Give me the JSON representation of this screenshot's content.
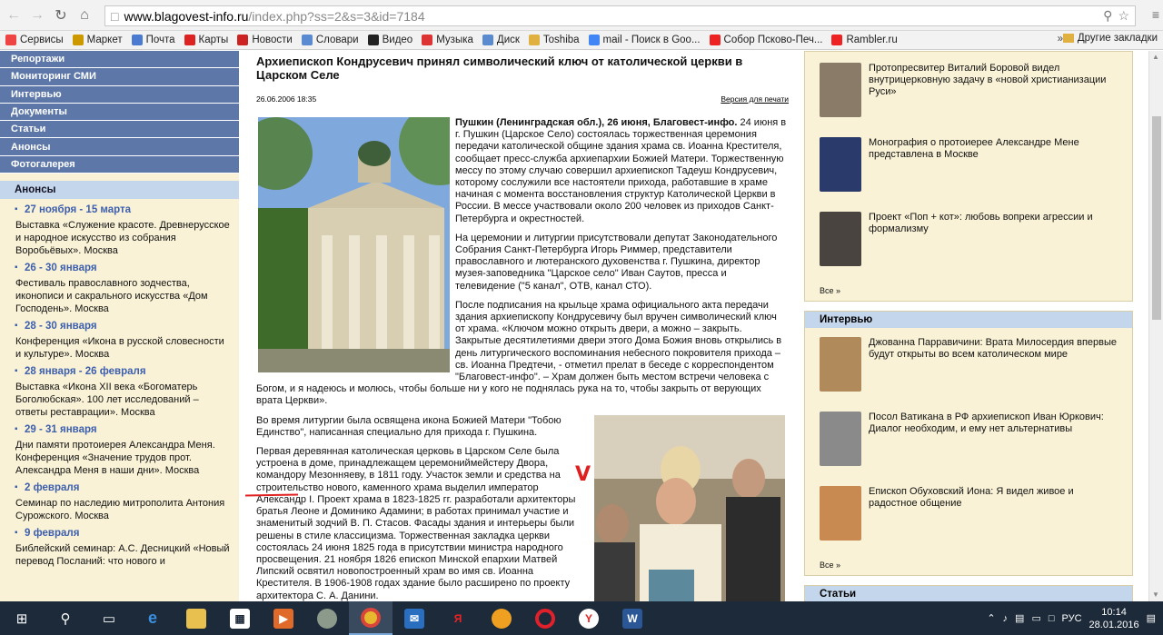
{
  "browser": {
    "url_domain": "www.blagovest-info.ru",
    "url_path": "/index.php?ss=2&s=3&id=7184",
    "bookmarks": [
      {
        "label": "Сервисы",
        "icon": "apps-icon",
        "color": "#e44"
      },
      {
        "label": "Маркет",
        "icon": "market-icon",
        "color": "#c90"
      },
      {
        "label": "Почта",
        "icon": "mail-icon",
        "color": "#4a7bd0"
      },
      {
        "label": "Карты",
        "icon": "map-pin-icon",
        "color": "#d22"
      },
      {
        "label": "Новости",
        "icon": "news-icon",
        "color": "#c22"
      },
      {
        "label": "Словари",
        "icon": "dictionary-icon",
        "color": "#5a8ad0"
      },
      {
        "label": "Видео",
        "icon": "video-icon",
        "color": "#222"
      },
      {
        "label": "Музыка",
        "icon": "music-icon",
        "color": "#d33"
      },
      {
        "label": "Диск",
        "icon": "disk-icon",
        "color": "#5a8ad0"
      },
      {
        "label": "Toshiba",
        "icon": "folder-icon",
        "color": "#e0b040"
      },
      {
        "label": "mail - Поиск в Goo...",
        "icon": "google-icon",
        "color": "#4285f4"
      },
      {
        "label": "Собор Псково-Печ...",
        "icon": "yandex-icon",
        "color": "#e22"
      },
      {
        "label": "Rambler.ru",
        "icon": "yandex-icon",
        "color": "#e22"
      }
    ],
    "more": "»",
    "other_bookmarks": "Другие закладки"
  },
  "left_menu": [
    "Репортажи",
    "Мониторинг СМИ",
    "Интервью",
    "Документы",
    "Статьи",
    "Анонсы",
    "Фотогалерея"
  ],
  "announcements": {
    "heading": "Анонсы",
    "items": [
      {
        "date": "27 ноября - 15 марта",
        "desc": "Выставка «Служение красоте. Древнерусское и народное искусство из собрания Воробьёвых». Москва"
      },
      {
        "date": "26 - 30 января",
        "desc": "Фестиваль православного зодчества, иконописи и сакрального искусства «Дом Господень». Москва"
      },
      {
        "date": "28 - 30 января",
        "desc": "Конференция «Икона в русской словесности и культуре». Москва"
      },
      {
        "date": "28 января - 26 февраля",
        "desc": "Выставка «Икона XII века «Богоматерь Боголюбская». 100 лет исследований – ответы реставрации». Москва"
      },
      {
        "date": "29 - 31 января",
        "desc": "Дни памяти протоиерея Александра Меня. Конференция «Значение трудов прот. Александра Меня в наши дни». Москва"
      },
      {
        "date": "2 февраля",
        "desc": "Семинар по наследию митрополита Антония Сурожского. Москва"
      },
      {
        "date": "9 февраля",
        "desc": "Библейский семинар: А.С. Десницкий «Новый перевод Посланий: что нового и"
      }
    ]
  },
  "article": {
    "title": "Архиепископ Кондрусевич принял символический ключ от католической церкви в Царском Селе",
    "date": "26.06.2006 18:35",
    "print_link": "Версия для печати",
    "lead_bold": "Пушкин (Ленинградская обл.),  26 июня, Благовест-инфо.",
    "p1": " 24 июня в г. Пушкин (Царское Село) состоялась торжественная церемония передачи католической общине здания храма св. Иоанна Крестителя, сообщает пресс-служба архиепархии Божией Матери. Торжественную мессу по этому случаю совершил архиепископ Тадеуш Кондрусевич, которому сослужили все настоятели прихода, работавшие в храме начиная с момента восстановления структур Католической Церкви в России. В мессе участвовали около 200 человек из приходов Санкт-Петербурга и окрестностей.",
    "p2": "На церемонии и литургии присутствовали депутат Законодательного Собрания Санкт-Петербурга Игорь Риммер, представители православного и лютеранского духовенства г. Пушкина, директор музея-заповедника \"Царское село\" Иван Саутов, пресса и телевидение (\"5 канал\", ОТВ, канал СТО).",
    "p3": "После подписания на крыльце храма официального акта передачи здания архиепископу Кондрусевичу был вручен символический ключ от храма. «Ключом можно открыть двери, а можно – закрыть. Закрытые десятилетиями двери этого Дома Божия вновь открылись в день литургического воспоминания небесного покровителя прихода – св. Иоанна Предтечи, - отметил прелат в беседе с корреспондентом \"Благовест-инфо\". – Храм должен быть местом встречи человека с Богом, и я надеюсь и молюсь, чтобы больше ни у кого не поднялась рука на то, чтобы закрыть от верующих врата Церкви».",
    "p4": "Во время литургии была освящена икона Божией Матери \"Тобою Единство\", написанная специально для прихода г. Пушкина.",
    "p5": "Первая деревянная католическая церковь в Царском Селе была устроена в доме, принадлежащем церемониймейстеру Двора, командору Мезонняеву, в 1811 году. Участок земли и средства на строительство нового, каменного храма выделил император Александр I. Проект храма  в 1823-1825 гг. разработали архитекторы братья Леоне и Доминико Адамини; в работах принимал участие и знаменитый зодчий В. П. Стасов. Фасады здания и интерьеры были решены в стиле классицизма. Торжественная закладка церкви состоялась 24 июня 1825 года в присутствии министра народного просвещения. 21 ноября 1826 епископ Минской епархии Матвей Липский освятил новопостроенный храм во имя  св. Иоанна Крестителя. В 1906-1908 годах здание было расширено по проекту архитектора С. А. Данини."
  },
  "right": {
    "box1": [
      {
        "text": "Протопресвитер Виталий Боровой видел внутрицерковную задачу в «новой христианизации Руси»"
      },
      {
        "text": "Монография о протоиерее Александре Мене представлена в Москве"
      },
      {
        "text": "Проект «Поп + кот»: любовь вопреки агрессии и формализму"
      }
    ],
    "all1": "Все »",
    "interview_head": "Интервью",
    "box2": [
      {
        "text": "Джованна Парравичини: Врата Милосердия впервые будут открыты во всем католическом мире"
      },
      {
        "text": "Посол Ватикана в РФ архиепископ Иван Юркович: Диалог необходим, и ему нет альтернативы"
      },
      {
        "text": "Епископ Обуховский Иона: Я видел живое и радостное общение"
      }
    ],
    "all2": "Все »",
    "articles_head": "Статьи"
  },
  "taskbar": {
    "lang": "РУС",
    "time": "10:14",
    "date": "28.01.2016"
  }
}
